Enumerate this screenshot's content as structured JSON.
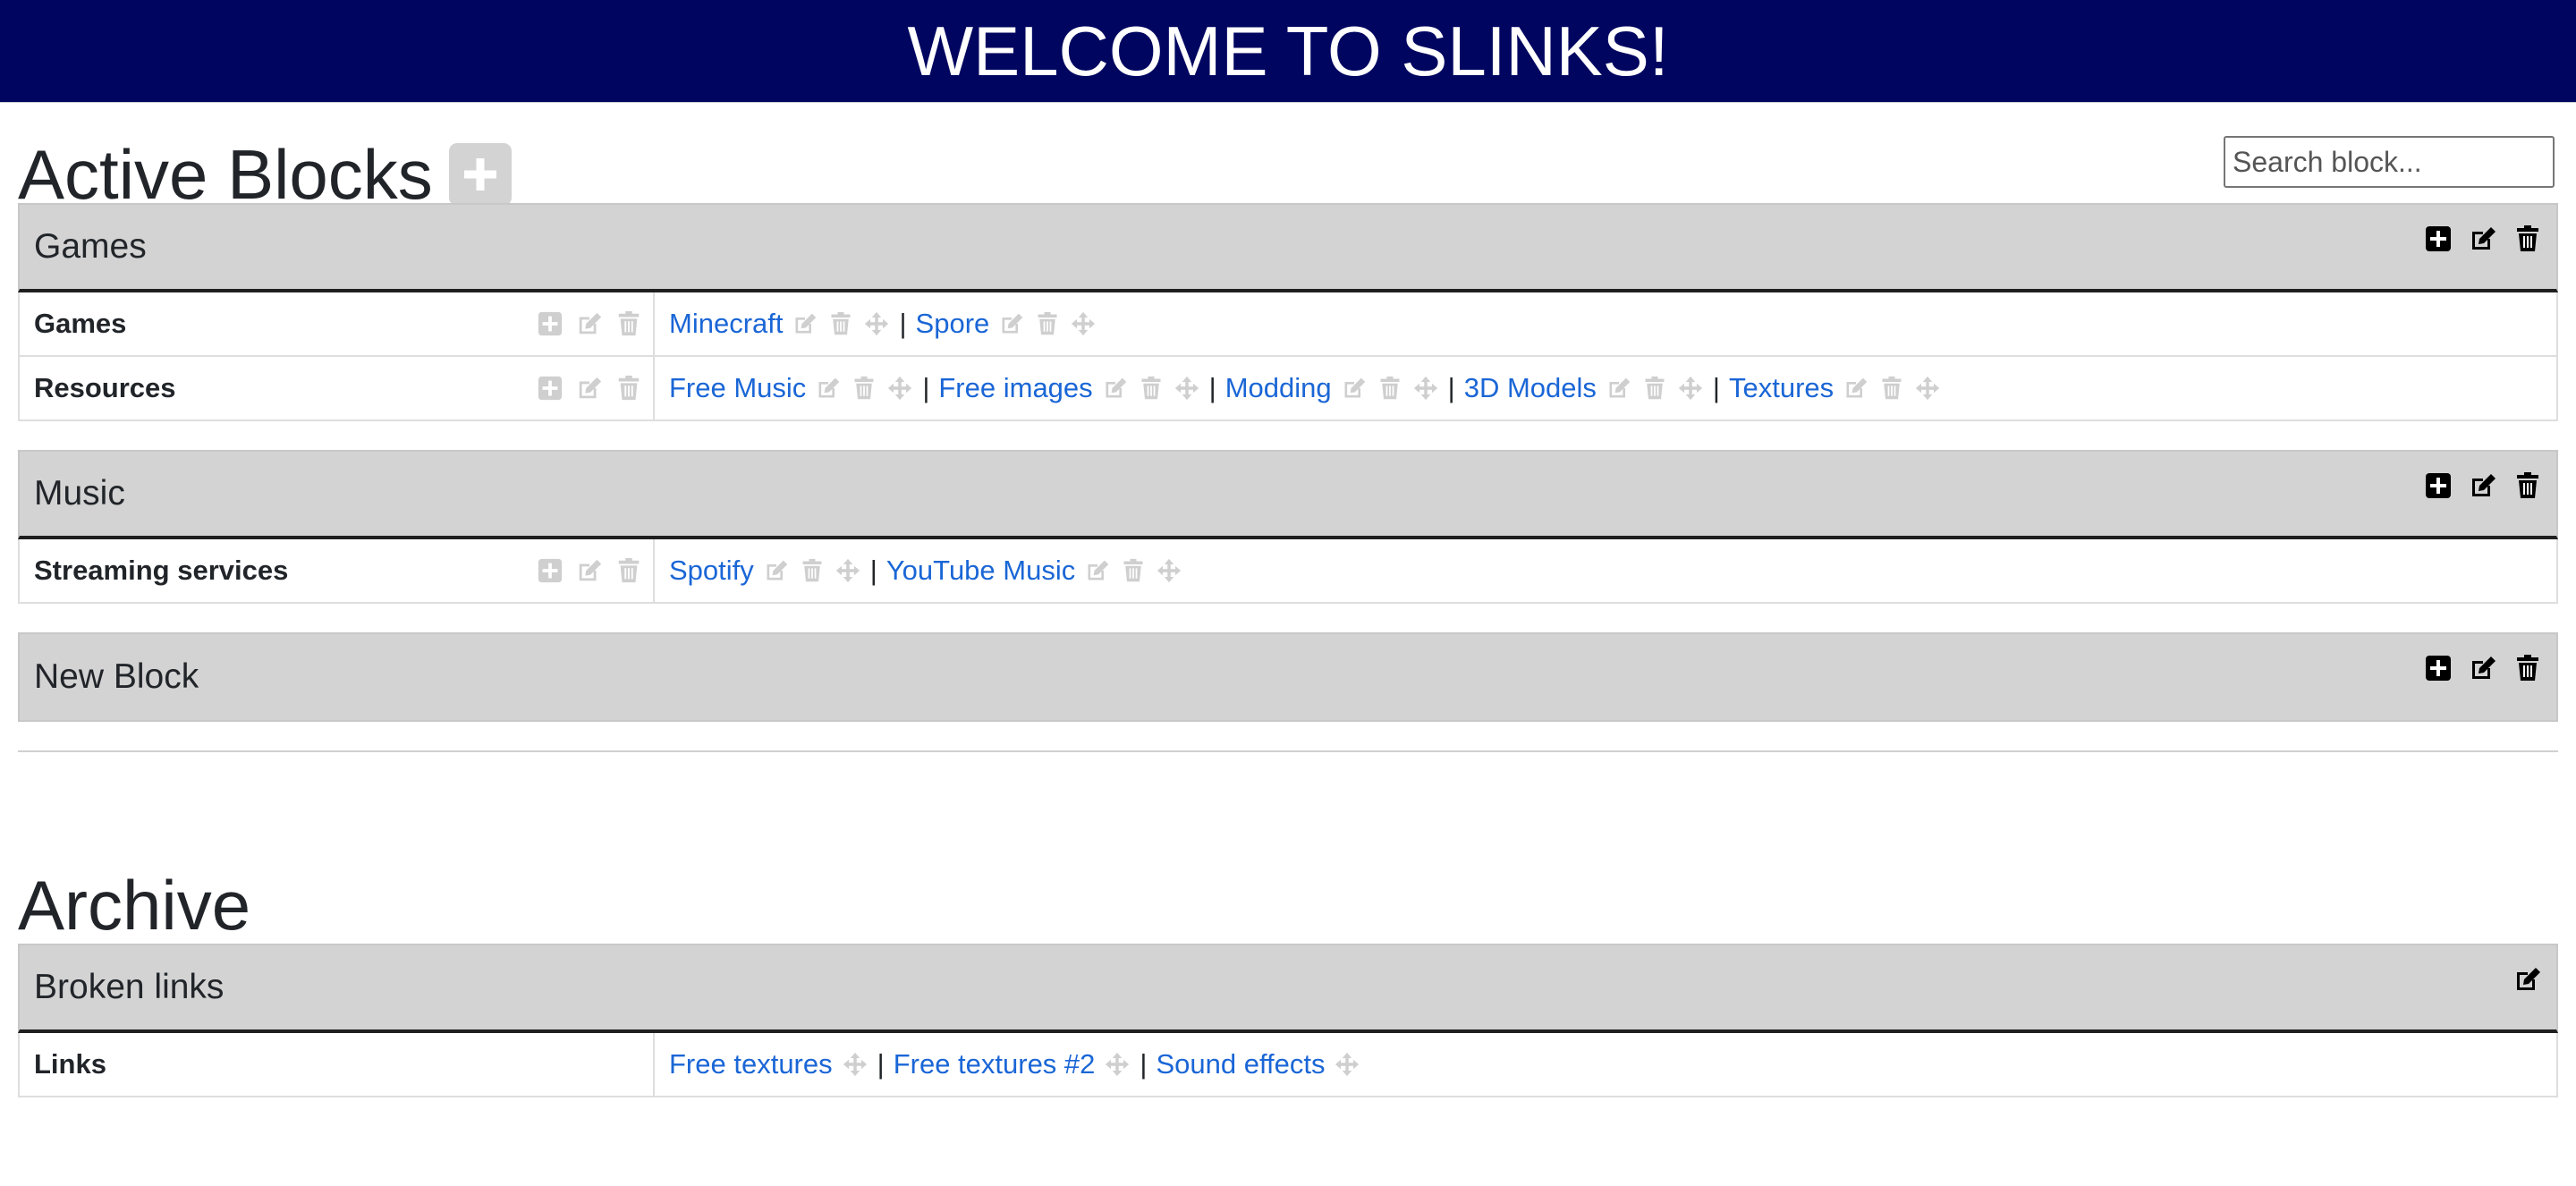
{
  "banner": {
    "title": "WELCOME TO SLINKS!"
  },
  "active": {
    "title": "Active Blocks",
    "search_placeholder": "Search block...",
    "blocks": [
      {
        "title": "Games",
        "rows": [
          {
            "label": "Games",
            "links": [
              "Minecraft",
              "Spore"
            ]
          },
          {
            "label": "Resources",
            "links": [
              "Free Music",
              "Free images",
              "Modding",
              "3D Models",
              "Textures"
            ]
          }
        ]
      },
      {
        "title": "Music",
        "rows": [
          {
            "label": "Streaming services",
            "links": [
              "Spotify",
              "YouTube Music"
            ]
          }
        ]
      },
      {
        "title": "New Block",
        "rows": []
      }
    ]
  },
  "archive": {
    "title": "Archive",
    "blocks": [
      {
        "title": "Broken links",
        "rows": [
          {
            "label": "Links",
            "links": [
              "Free textures",
              "Free textures #2",
              "Sound effects"
            ]
          }
        ]
      }
    ]
  },
  "link_separator": "|",
  "colors": {
    "banner": "#000660",
    "link": "#1a66d6",
    "block_header": "#d3d3d3",
    "muted_icon": "#cfcfcf"
  }
}
